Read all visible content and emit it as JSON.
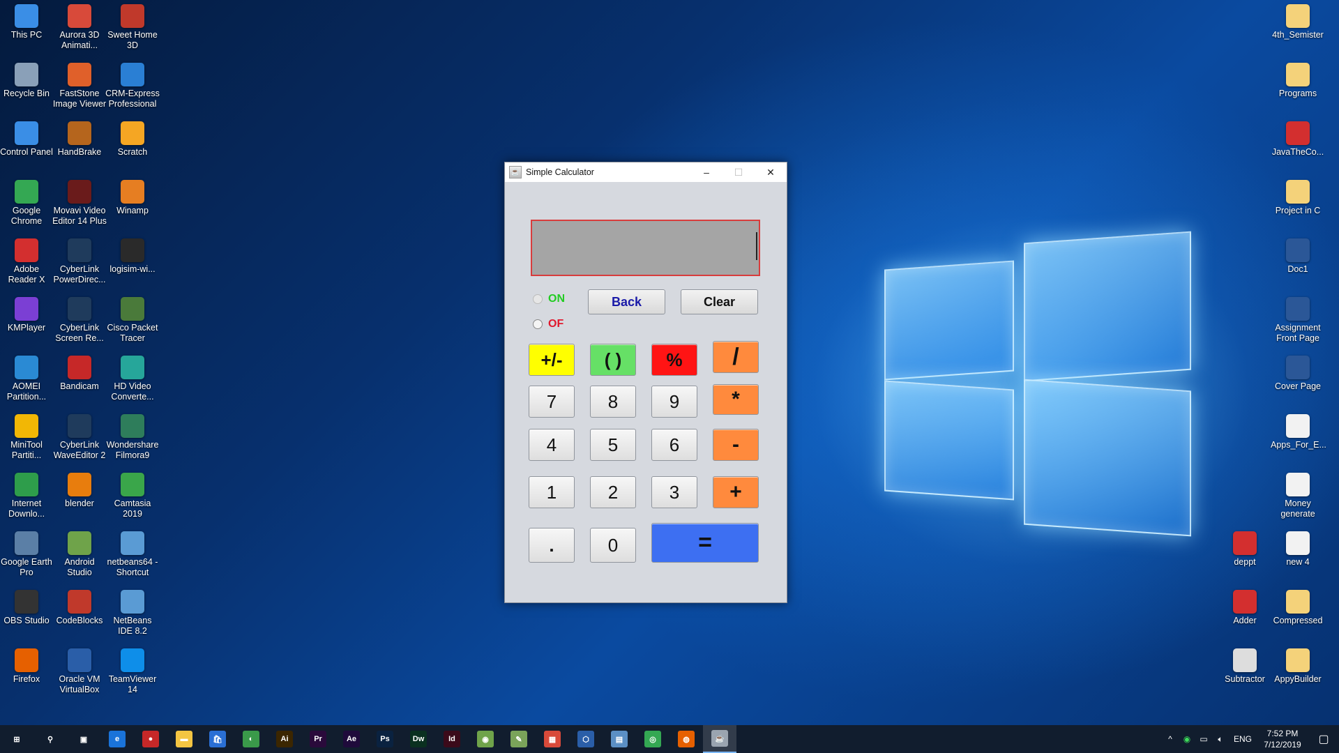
{
  "desktop": {
    "left_icons": [
      {
        "label": "This PC",
        "icon": "computer-icon",
        "color": "#3a8ee6"
      },
      {
        "label": "Aurora 3D Animati...",
        "icon": "aurora-icon",
        "color": "#d84a3a"
      },
      {
        "label": "Sweet Home 3D",
        "icon": "house-icon",
        "color": "#c0392b"
      },
      {
        "label": "Recycle Bin",
        "icon": "recycle-bin-icon",
        "color": "#8aa0b8"
      },
      {
        "label": "FastStone Image Viewer",
        "icon": "faststone-icon",
        "color": "#e0602a"
      },
      {
        "label": "CRM-Express Professional",
        "icon": "shortcut-icon",
        "color": "#2a7fd4"
      },
      {
        "label": "Control Panel",
        "icon": "control-panel-icon",
        "color": "#3a8ee6"
      },
      {
        "label": "HandBrake",
        "icon": "pineapple-icon",
        "color": "#b5651d"
      },
      {
        "label": "Scratch",
        "icon": "cat-icon",
        "color": "#f5a623"
      },
      {
        "label": "Google Chrome",
        "icon": "chrome-icon",
        "color": "#34a853"
      },
      {
        "label": "Movavi Video Editor 14 Plus",
        "icon": "movavi-icon",
        "color": "#6a1b1b"
      },
      {
        "label": "Winamp",
        "icon": "winamp-icon",
        "color": "#e67e22"
      },
      {
        "label": "Adobe Reader X",
        "icon": "pdf-icon",
        "color": "#d32f2f"
      },
      {
        "label": "CyberLink PowerDirec...",
        "icon": "powerdirector-icon",
        "color": "#1f3b5c"
      },
      {
        "label": "logisim-wi...",
        "icon": "logisim-icon",
        "color": "#2a2a2a"
      },
      {
        "label": "KMPlayer",
        "icon": "kmplayer-icon",
        "color": "#7b3fd4"
      },
      {
        "label": "CyberLink Screen Re...",
        "icon": "screen-recorder-icon",
        "color": "#1f3b5c"
      },
      {
        "label": "Cisco Packet Tracer",
        "icon": "cisco-icon",
        "color": "#4a7a3a"
      },
      {
        "label": "AOMEI Partition...",
        "icon": "aomei-icon",
        "color": "#2a8ad4"
      },
      {
        "label": "Bandicam",
        "icon": "bandicam-icon",
        "color": "#c62828"
      },
      {
        "label": "HD Video Converte...",
        "icon": "hd-video-icon",
        "color": "#26a69a"
      },
      {
        "label": "MiniTool Partiti...",
        "icon": "minitool-icon",
        "color": "#f2b705"
      },
      {
        "label": "CyberLink WaveEditor 2",
        "icon": "waveeditor-icon",
        "color": "#1f3b5c"
      },
      {
        "label": "Wondershare Filmora9",
        "icon": "filmora-icon",
        "color": "#2e7d5b"
      },
      {
        "label": "Internet Downlo...",
        "icon": "idm-icon",
        "color": "#2e9d4b"
      },
      {
        "label": "blender",
        "icon": "blender-icon",
        "color": "#e87d0d"
      },
      {
        "label": "Camtasia 2019",
        "icon": "camtasia-icon",
        "color": "#3aa64a"
      },
      {
        "label": "Google Earth Pro",
        "icon": "earth-icon",
        "color": "#5b7fa6"
      },
      {
        "label": "Android Studio",
        "icon": "android-icon",
        "color": "#6fa34a"
      },
      {
        "label": "netbeans64 - Shortcut",
        "icon": "netbeans-icon",
        "color": "#5a9bd4"
      },
      {
        "label": "OBS Studio",
        "icon": "obs-icon",
        "color": "#333333"
      },
      {
        "label": "CodeBlocks",
        "icon": "codeblocks-icon",
        "color": "#c0392b"
      },
      {
        "label": "NetBeans IDE 8.2",
        "icon": "netbeans-icon",
        "color": "#5a9bd4"
      },
      {
        "label": "Firefox",
        "icon": "firefox-icon",
        "color": "#e66000"
      },
      {
        "label": "Oracle VM VirtualBox",
        "icon": "virtualbox-icon",
        "color": "#2a5ea8"
      },
      {
        "label": "TeamViewer 14",
        "icon": "teamviewer-icon",
        "color": "#0e8ee9"
      }
    ],
    "right_icons": [
      {
        "label": "4th_Semister",
        "icon": "folder-icon",
        "color": "#f4d27a"
      },
      {
        "label": "Programs",
        "icon": "folder-icon",
        "color": "#f4d27a"
      },
      {
        "label": "JavaTheCo...",
        "icon": "pdf-icon",
        "color": "#d32f2f"
      },
      {
        "label": "Project in C",
        "icon": "folder-icon",
        "color": "#f4d27a"
      },
      {
        "label": "Doc1",
        "icon": "word-doc-icon",
        "color": "#2b5797"
      },
      {
        "label": "Assignment Front Page",
        "icon": "word-doc-icon",
        "color": "#2b5797"
      },
      {
        "label": "Cover Page",
        "icon": "word-doc-icon",
        "color": "#2b5797"
      },
      {
        "label": "Apps_For_E...",
        "icon": "text-file-icon",
        "color": "#f2f2f2"
      },
      {
        "label": "Money generate",
        "icon": "text-file-icon",
        "color": "#f2f2f2"
      },
      {
        "label": "deppt",
        "icon": "pdf-icon",
        "color": "#d32f2f"
      },
      {
        "label": "new 4",
        "icon": "text-file-icon",
        "color": "#f2f2f2"
      },
      {
        "label": "Adder",
        "icon": "pdf-icon",
        "color": "#d32f2f"
      },
      {
        "label": "Compressed",
        "icon": "archive-icon",
        "color": "#f4d27a"
      },
      {
        "label": "Subtractor",
        "icon": "keyboard-icon",
        "color": "#dddddd"
      },
      {
        "label": "AppyBuilder",
        "icon": "archive-icon",
        "color": "#f4d27a"
      }
    ]
  },
  "window": {
    "title": "Simple Calculator",
    "minimize": "–",
    "maximize": "☐",
    "close": "✕",
    "display_value": "",
    "radio_on_label": "ON",
    "radio_off_label": "OF",
    "radio_on_color": "#22cc22",
    "radio_off_color": "#e0182d",
    "back_label": "Back",
    "back_color": "#1a1aa8",
    "clear_label": "Clear",
    "row1": [
      {
        "label": "+/-",
        "bg": "#ffff00",
        "fg": "#111111"
      },
      {
        "label": "( )",
        "bg": "#66e066",
        "fg": "#111111"
      },
      {
        "label": "%",
        "bg": "#ff1414",
        "fg": "#111111"
      },
      {
        "label": "/",
        "bg": "#ff8a3d",
        "fg": "#111111"
      }
    ],
    "keys": {
      "seven": "7",
      "eight": "8",
      "nine": "9",
      "multiply": "*",
      "four": "4",
      "five": "5",
      "six": "6",
      "minus": "-",
      "one": "1",
      "two": "2",
      "three": "3",
      "plus": "+",
      "dot": ".",
      "zero": "0",
      "equals": "="
    },
    "operator_color": "#ff8a3d",
    "equals_color": "#3d6ff2"
  },
  "taskbar": {
    "apps": [
      {
        "name": "start-icon",
        "glyph": "⊞",
        "color": "transparent"
      },
      {
        "name": "search-icon",
        "glyph": "⚲",
        "color": "transparent"
      },
      {
        "name": "task-view-icon",
        "glyph": "▣",
        "color": "transparent"
      },
      {
        "name": "edge-icon",
        "glyph": "e",
        "color": "#1a73d9"
      },
      {
        "name": "record-icon",
        "glyph": "●",
        "color": "#c62828"
      },
      {
        "name": "file-explorer-icon",
        "glyph": "▬",
        "color": "#f4c542"
      },
      {
        "name": "store-icon",
        "glyph": "🛍",
        "color": "#2a6fd4"
      },
      {
        "name": "earth-icon",
        "glyph": "◐",
        "color": "#3a9a4a"
      },
      {
        "name": "illustrator-icon",
        "glyph": "Ai",
        "color": "#3b2600"
      },
      {
        "name": "premiere-icon",
        "glyph": "Pr",
        "color": "#2a0a3b"
      },
      {
        "name": "after-effects-icon",
        "glyph": "Ae",
        "color": "#1f0a3b"
      },
      {
        "name": "photoshop-icon",
        "glyph": "Ps",
        "color": "#0a2240"
      },
      {
        "name": "dreamweaver-icon",
        "glyph": "Dw",
        "color": "#0a3020"
      },
      {
        "name": "indesign-icon",
        "glyph": "Id",
        "color": "#3b0a1a"
      },
      {
        "name": "android-studio-icon",
        "glyph": "◉",
        "color": "#6fa34a"
      },
      {
        "name": "notepad-icon",
        "glyph": "✎",
        "color": "#7aa35a"
      },
      {
        "name": "tiles-icon",
        "glyph": "▦",
        "color": "#d84a3a"
      },
      {
        "name": "virtualbox-icon",
        "glyph": "⬡",
        "color": "#2a5ea8"
      },
      {
        "name": "book-icon",
        "glyph": "▤",
        "color": "#5b8fc4"
      },
      {
        "name": "chrome-icon",
        "glyph": "◎",
        "color": "#34a853"
      },
      {
        "name": "firefox-icon",
        "glyph": "◍",
        "color": "#e66000"
      },
      {
        "name": "java-app-icon",
        "glyph": "☕",
        "color": "#9aa4b0"
      }
    ],
    "tray": {
      "chevron": "^",
      "language": "ENG",
      "time": "7:52 PM",
      "date": "7/12/2019"
    }
  }
}
